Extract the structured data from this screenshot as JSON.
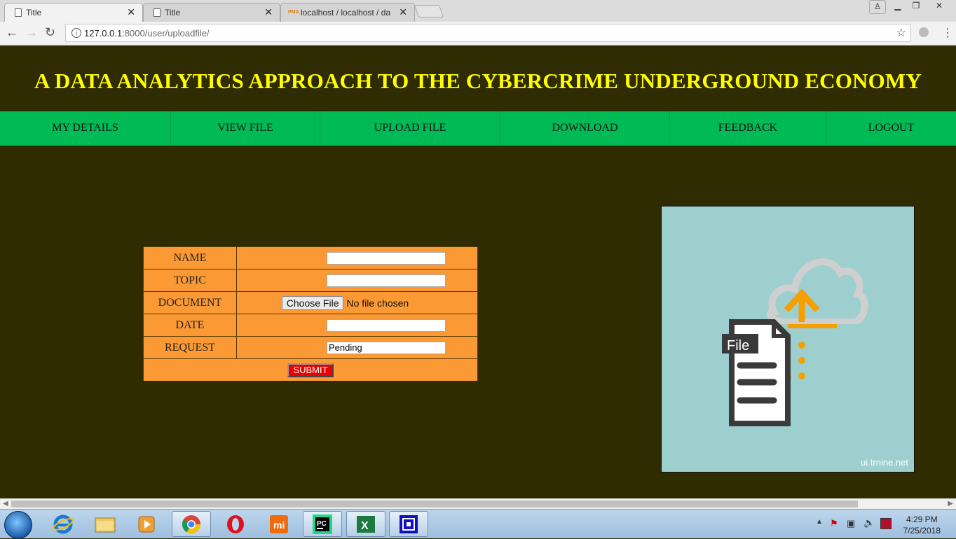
{
  "browser": {
    "tabs": [
      {
        "title": "Title",
        "active": true
      },
      {
        "title": "Title",
        "active": false
      },
      {
        "title": "localhost / localhost / da",
        "active": false
      }
    ],
    "url_host": "127.0.0.1",
    "url_path": ":8000/user/uploadfile/"
  },
  "page": {
    "title": "A DATA ANALYTICS APPROACH TO THE CYBERCRIME UNDERGROUND ECONOMY",
    "menu": [
      {
        "label": "MY DETAILS"
      },
      {
        "label": "VIEW FILE"
      },
      {
        "label": "UPLOAD FILE"
      },
      {
        "label": "DOWNLOAD"
      },
      {
        "label": "FEEDBACK"
      },
      {
        "label": "LOGOUT"
      }
    ],
    "form": {
      "name_label": "NAME",
      "name_value": "",
      "topic_label": "TOPIC",
      "topic_value": "",
      "document_label": "DOCUMENT",
      "choose_file_label": "Choose File",
      "no_file_text": "No file chosen",
      "date_label": "DATE",
      "date_value": "",
      "request_label": "REQUEST",
      "request_value": "Pending",
      "submit_label": "SUBMIT"
    },
    "illustration": {
      "file_label": "File",
      "watermark": "ui.trnine.net"
    }
  },
  "taskbar": {
    "time": "4:29 PM",
    "date": "7/25/2018"
  },
  "colors": {
    "page_bg": "#2e2c00",
    "title_yellow": "#ffff00",
    "menu_green": "#00bb55",
    "form_orange": "#fb9a34",
    "submit_red": "#ee0000",
    "image_bg": "#9ecfcf"
  }
}
